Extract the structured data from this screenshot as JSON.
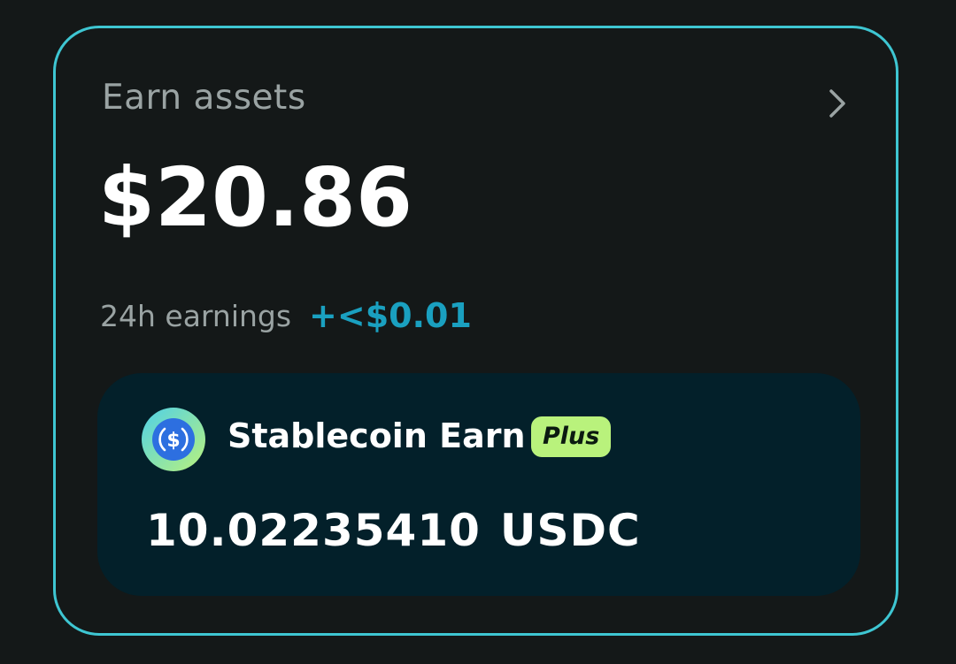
{
  "card": {
    "title": "Earn assets",
    "chevron_icon": "chevron-right-icon",
    "total": "$20.86",
    "earnings_label": "24h earnings",
    "earnings_value": "+<$0.01",
    "border_color": "#3ec6d2"
  },
  "product": {
    "icon": "usdc-coin-icon",
    "name": "Stablecoin Earn",
    "badge": "Plus",
    "amount": "10.02235410",
    "unit": "USDC",
    "badge_color": "#b9f27c"
  },
  "colors": {
    "background": "#141818",
    "inner_background": "#03202a",
    "earnings_accent": "#1aa0c0",
    "muted_text": "#9aa3a3"
  }
}
